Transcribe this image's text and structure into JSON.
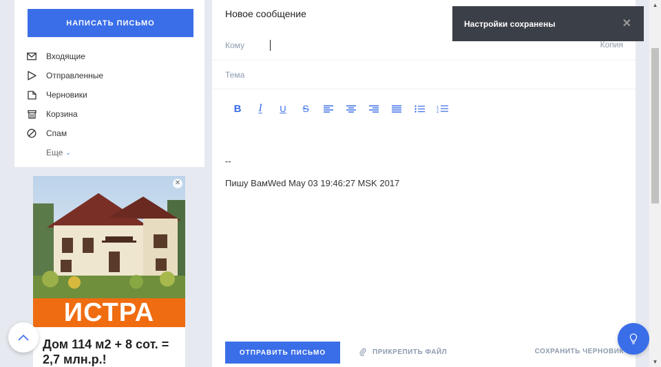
{
  "sidebar": {
    "compose_label": "НАПИСАТЬ ПИСЬМО",
    "items": [
      {
        "label": "Входящие",
        "icon": "inbox-icon"
      },
      {
        "label": "Отправленные",
        "icon": "send-icon"
      },
      {
        "label": "Черновики",
        "icon": "draft-icon"
      },
      {
        "label": "Корзина",
        "icon": "trash-icon"
      },
      {
        "label": "Спам",
        "icon": "spam-icon"
      }
    ],
    "more_label": "Еще"
  },
  "ad": {
    "banner_text": "ИСТРА",
    "text": "Дом 114 м2 + 8 сот. = 2,7 млн.р.!"
  },
  "compose": {
    "title": "Новое сообщение",
    "to_label": "Кому",
    "to_value": "",
    "copy_label": "Копия",
    "subject_label": "Тема",
    "toolbar": [
      "bold-icon",
      "italic-icon",
      "underline-icon",
      "strikethrough-icon",
      "align-left-icon",
      "align-center-icon",
      "align-right-icon",
      "align-justify-icon",
      "bullet-list-icon",
      "numbered-list-icon"
    ],
    "body_lines": [
      "--",
      "Пишу ВамWed May 03 19:46:27 MSK 2017"
    ],
    "send_label": "ОТПРАВИТЬ ПИСЬМО",
    "attach_label": "ПРИКРЕПИТЬ ФАЙЛ",
    "save_draft_label": "СОХРАНИТЬ ЧЕРНОВИК"
  },
  "toast": {
    "message": "Настройки сохранены"
  },
  "colors": {
    "accent": "#3a6ee8",
    "toast_bg": "#3b3f47",
    "ad_banner": "#f06c10",
    "page_bg": "#e6e9ef"
  }
}
